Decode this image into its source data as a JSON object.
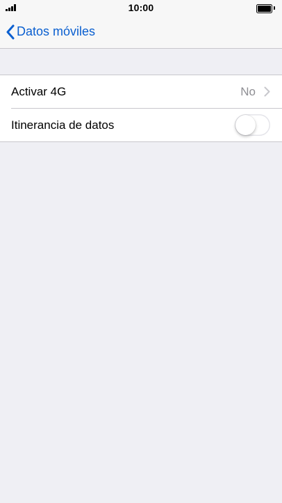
{
  "status_bar": {
    "time": "10:00",
    "signal_icon": "signal-bars-icon",
    "battery_icon": "battery-full-icon",
    "battery_level": 1.0
  },
  "nav": {
    "back_label": "Datos móviles",
    "back_icon": "chevron-left-icon",
    "accent_color": "#0a5fd0"
  },
  "settings": {
    "rows": [
      {
        "label": "Activar 4G",
        "value": "No",
        "icon": "chevron-right-icon"
      },
      {
        "label": "Itinerancia de datos",
        "toggle_on": false
      }
    ]
  }
}
